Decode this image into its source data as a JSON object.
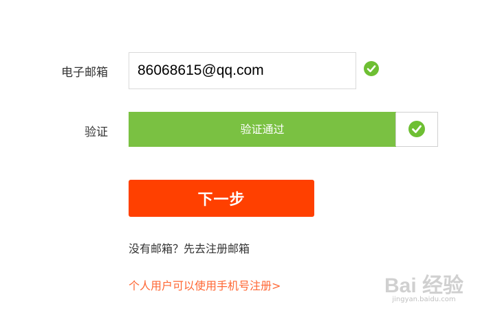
{
  "form": {
    "email_label": "电子邮箱",
    "email_value": "86068615@qq.com",
    "verify_label": "验证",
    "verify_status": "验证通过",
    "next_button": "下一步",
    "no_email_prefix": "没有邮箱？",
    "register_email_link": "先去注册邮箱",
    "personal_link": "个人用户可以使用手机号注册>"
  },
  "watermark": {
    "logo": "Bai 经验",
    "url": "jingyan.baidu.com"
  },
  "colors": {
    "success_green": "#7ac142",
    "check_green": "#6ebf33",
    "primary_orange": "#ff4000",
    "link_orange": "#ff6633"
  },
  "icons": {
    "email_valid": "check-circle-icon",
    "verify_done": "check-circle-icon"
  }
}
